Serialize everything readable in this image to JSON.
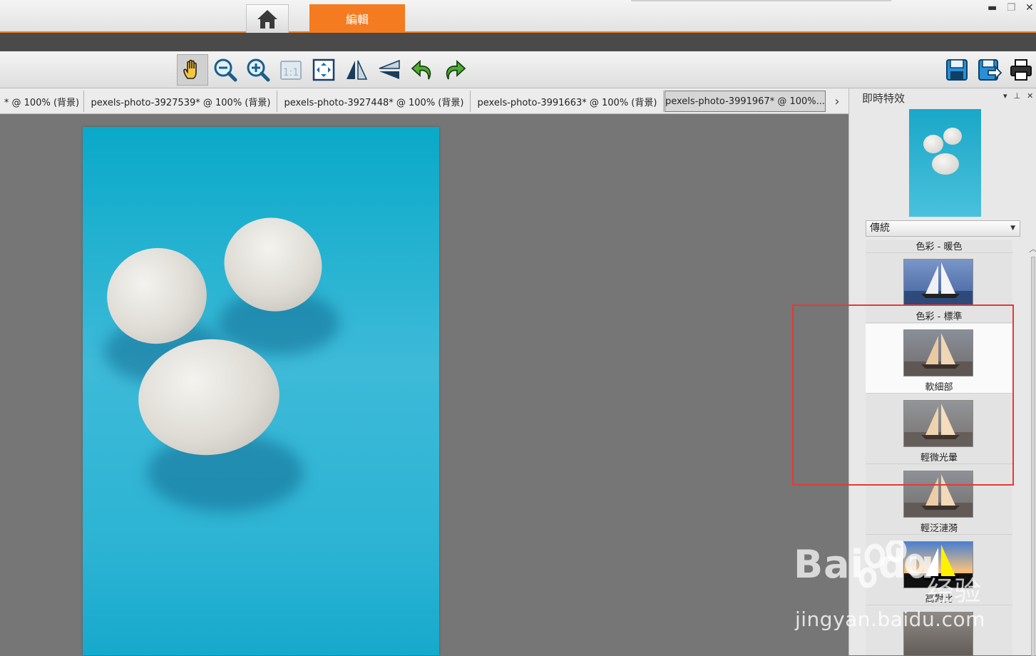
{
  "app": {
    "tabs": {
      "edit_label": "編輯"
    },
    "window_controls": {
      "minimize": "▬",
      "restore": "❐",
      "close": "✕"
    }
  },
  "toolbar": {
    "tools": [
      "hand-icon",
      "zoom-out-icon",
      "zoom-in-icon",
      "actual-size-icon",
      "fit-to-window-icon",
      "flip-horizontal-icon",
      "flip-vertical-icon",
      "undo-icon",
      "redo-icon"
    ],
    "actual_size_label": "1:1",
    "file_tools": [
      "save-icon",
      "save-as-icon",
      "print-icon"
    ]
  },
  "document_tabs": [
    {
      "label": "* @ 100% (背景)",
      "active": false
    },
    {
      "label": "pexels-photo-3927539* @ 100% (背景)",
      "active": false
    },
    {
      "label": "pexels-photo-3927448* @ 100% (背景)",
      "active": false
    },
    {
      "label": "pexels-photo-3991663* @ 100% (背景)",
      "active": false
    },
    {
      "label": "pexels-photo-3991967* @ 100%...",
      "active": true
    }
  ],
  "panel": {
    "title": "即時特效",
    "category_select": "傳統",
    "effects": [
      {
        "label": "色彩 - 暖色",
        "selected": false
      },
      {
        "label": "色彩 - 標準",
        "selected": false
      },
      {
        "label": "軟細部",
        "selected": true
      },
      {
        "label": "輕微光暈",
        "selected": false
      },
      {
        "label": "輕泛漣漪",
        "selected": false
      },
      {
        "label": "高對比",
        "selected": false
      }
    ]
  },
  "watermark": {
    "logo": "Bai du",
    "sub": "经验",
    "url": "jingyan.baidu.com"
  },
  "colors": {
    "accent": "#f47b20",
    "highlight": "#e33a3a"
  }
}
